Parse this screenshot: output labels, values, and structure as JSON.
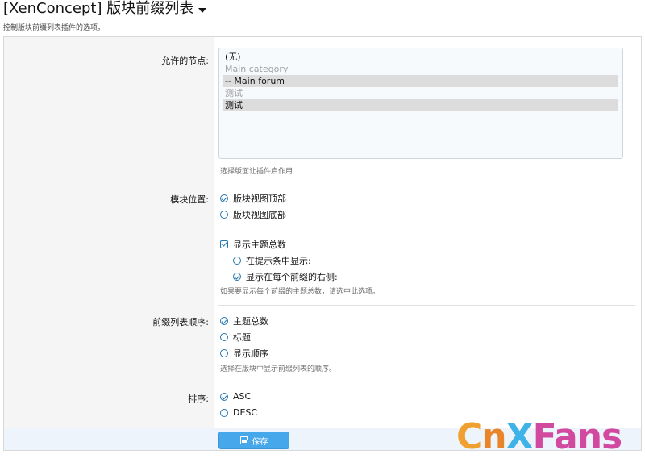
{
  "header": {
    "title": "[XenConcept] 版块前缀列表",
    "description": "控制版块前缀列表插件的选项。"
  },
  "nodes": {
    "label": "允许的节点:",
    "options": [
      {
        "text": "(无)",
        "state": "normal"
      },
      {
        "text": "Main category",
        "state": "disabled"
      },
      {
        "text": "-- Main forum",
        "state": "selected"
      },
      {
        "text": "测试",
        "state": "disabled"
      },
      {
        "text": "测试",
        "state": "selected"
      }
    ],
    "hint": "选择版面让插件启作用"
  },
  "position": {
    "label": "模块位置:",
    "options": [
      {
        "text": "版块视图顶部",
        "checked": true
      },
      {
        "text": "版块视图底部",
        "checked": false
      }
    ],
    "show_count": {
      "text": "显示主题总数",
      "checked": true,
      "sub_options": [
        {
          "text": "在提示条中显示:",
          "checked": false
        },
        {
          "text": "显示在每个前缀的右侧:",
          "checked": true
        }
      ]
    },
    "hint": "如果要显示每个前缀的主题总数，请选中此选项。"
  },
  "order": {
    "label": "前缀列表顺序:",
    "options": [
      {
        "text": "主题总数",
        "checked": true
      },
      {
        "text": "标题",
        "checked": false
      },
      {
        "text": "显示顺序",
        "checked": false
      }
    ],
    "hint": "选择在版块中显示前缀列表的顺序。"
  },
  "sort": {
    "label": "排序:",
    "options": [
      {
        "text": "ASC",
        "checked": true
      },
      {
        "text": "DESC",
        "checked": false
      }
    ]
  },
  "footer": {
    "save_label": "保存"
  },
  "watermark": {
    "c": "C",
    "n": "n",
    "x": "X",
    "fans": "Fans"
  },
  "colors": {
    "accent": "#2577b1",
    "button": "#47a7eb",
    "footer_bg": "#edf4fb"
  }
}
